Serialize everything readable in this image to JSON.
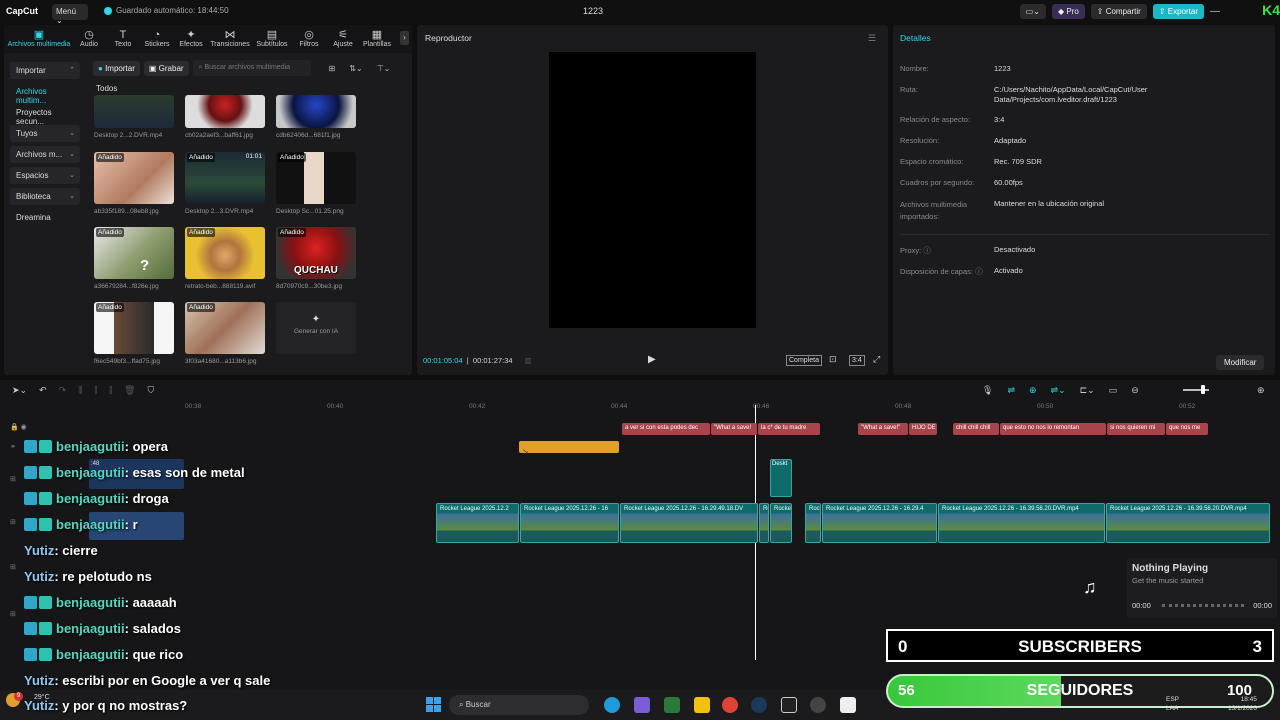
{
  "app": {
    "logo": "CapCut",
    "menu": "Menú",
    "autosave": "Guardado automático: 18:44:50",
    "project_title": "1223",
    "pro": "Pro",
    "share": "Compartir",
    "export": "Exportar",
    "overlay_badge": "K4"
  },
  "toolbar": {
    "tabs": [
      {
        "label": "Archivos multimedia",
        "icon": "media-icon"
      },
      {
        "label": "Audio",
        "icon": "audio-icon"
      },
      {
        "label": "Texto",
        "icon": "text-icon"
      },
      {
        "label": "Stickers",
        "icon": "sticker-icon"
      },
      {
        "label": "Efectos",
        "icon": "effects-icon"
      },
      {
        "label": "Transiciones",
        "icon": "transitions-icon"
      },
      {
        "label": "Subtítulos",
        "icon": "subtitles-icon"
      },
      {
        "label": "Filtros",
        "icon": "filters-icon"
      },
      {
        "label": "Ajuste",
        "icon": "adjust-icon"
      },
      {
        "label": "Plantillas",
        "icon": "templates-icon"
      }
    ]
  },
  "sidebar": {
    "items": [
      "Importar",
      "Archivos multim...",
      "Proyectos secun...",
      "Tuyos",
      "Archivos m...",
      "Espacios",
      "Biblioteca",
      "Dreamina"
    ]
  },
  "library": {
    "import_btn": "Importar",
    "record_btn": "Grabar",
    "search_placeholder": "Buscar archivos multimedia",
    "section": "Todos",
    "added": "Añadido",
    "items": [
      {
        "name": "Desktop 2...2.DVR.mp4"
      },
      {
        "name": "cb02a2aef3...baff61.jpg"
      },
      {
        "name": "cdb62406d...681f1.jpg"
      },
      {
        "name": "ab335f189...08eb8.jpg"
      },
      {
        "name": "Desktop 2...3.DVR.mp4",
        "duration": "01:01"
      },
      {
        "name": "Desktop Sc...01.25.png"
      },
      {
        "name": "a36679284...f826e.jpg"
      },
      {
        "name": "retrato-beb...888119.avif"
      },
      {
        "name": "8d70970c9...30be3.jpg",
        "overlay_text": "QUCHAU"
      },
      {
        "name": "f6ec549bf3...ffad75.jpg"
      },
      {
        "name": "3f03a41680...a113b6.jpg"
      }
    ],
    "generate_ai": "Generar con IA"
  },
  "player": {
    "title": "Reproductor",
    "current": "00:01:05:04",
    "total": "00:01:27:34",
    "fit": "Completa",
    "ratio": "3:4"
  },
  "details": {
    "title": "Detalles",
    "rows": [
      {
        "label": "Nombre:",
        "value": "1223"
      },
      {
        "label": "Ruta:",
        "value": "C:/Users/Nachito/AppData/Local/CapCut/User Data/Projects/com.lveditor.draft/1223"
      },
      {
        "label": "Relación de aspecto:",
        "value": "3:4"
      },
      {
        "label": "Resolución:",
        "value": "Adaptado"
      },
      {
        "label": "Espacio cromático:",
        "value": "Rec. 709 SDR"
      },
      {
        "label": "Cuadros por segundo:",
        "value": "60.00fps"
      },
      {
        "label": "Archivos multimedia importados:",
        "value": "Mantener en la ubicación original"
      },
      {
        "label": "Proxy:",
        "value": "Desactivado"
      },
      {
        "label": "Disposición de capas:",
        "value": "Activado"
      }
    ],
    "modify": "Modificar"
  },
  "timeline": {
    "ruler": [
      "00:38",
      "00:40",
      "00:42",
      "00:44",
      "00:46",
      "00:48",
      "00:50",
      "00:52"
    ],
    "text_clips": [
      "a ver si con esta podes dec",
      "\"What a save!",
      "la c* de tu madre",
      "\"What a save!\"",
      "HIJO DE",
      "chill chill chill",
      "que esto no nos lo remontan",
      "si nos quieren mi",
      "que nos me"
    ],
    "video_clips": [
      "Rocket League 2025.12.2",
      "Rocket League 2025.12.26 - 16",
      "Rocket League 2025.12.26 - 16.29.49.18.DV",
      "Ro",
      "Rocke",
      "Roc",
      "Rocket League 2025.12.26 - 16.29.4",
      "Rocket League 2025.12.26 - 16.39.58.20.DVR.mp4",
      "Rocket League 2025.12.26 - 16.39.58.20.DVR.mp4"
    ],
    "small_clip": "Deskt",
    "left_clip_time": ":48"
  },
  "chat": [
    {
      "user": "benjaagutii",
      "msg": ": opera",
      "icons": true
    },
    {
      "user": "benjaagutii",
      "msg": ": esas son de metal",
      "icons": true
    },
    {
      "user": "benjaagutii",
      "msg": ": droga",
      "icons": true
    },
    {
      "user": "benjaagutii",
      "msg": ": r",
      "icons": true
    },
    {
      "user": "Yutiz",
      "msg": ": cierre",
      "icons": false
    },
    {
      "user": "Yutiz",
      "msg": ": re pelotudo ns",
      "icons": false
    },
    {
      "user": "benjaagutii",
      "msg": ": aaaaah",
      "icons": true
    },
    {
      "user": "benjaagutii",
      "msg": ": salados",
      "icons": true
    },
    {
      "user": "benjaagutii",
      "msg": ": que rico",
      "icons": true
    },
    {
      "user": "Yutiz",
      "msg": ": escribi por en Google a ver q sale",
      "icons": false
    },
    {
      "user": "Yutiz",
      "msg": ": y por q no mostras?",
      "icons": false
    }
  ],
  "now_playing": {
    "title": "Nothing Playing",
    "subtitle": "Get the music started",
    "start": "00:00",
    "end": "00:00"
  },
  "subscribers": {
    "left": "0",
    "label": "SUBSCRIBERS",
    "right": "3"
  },
  "followers": {
    "left": "56",
    "label": "SEGUIDORES",
    "right": "100",
    "progress": 0.56
  },
  "taskbar": {
    "weather": "29°C",
    "notif": "9",
    "search": "Buscar",
    "lang1": "ESP",
    "lang2": "LAA",
    "time": "18:45",
    "date": "13/1/2026"
  },
  "colors": {
    "accent": "#2fd8e8",
    "text_clip": "#a8444b",
    "video_clip": "#0f6a6a",
    "audio_clip": "#e0a02a",
    "followers_bar": "#37c83a"
  }
}
